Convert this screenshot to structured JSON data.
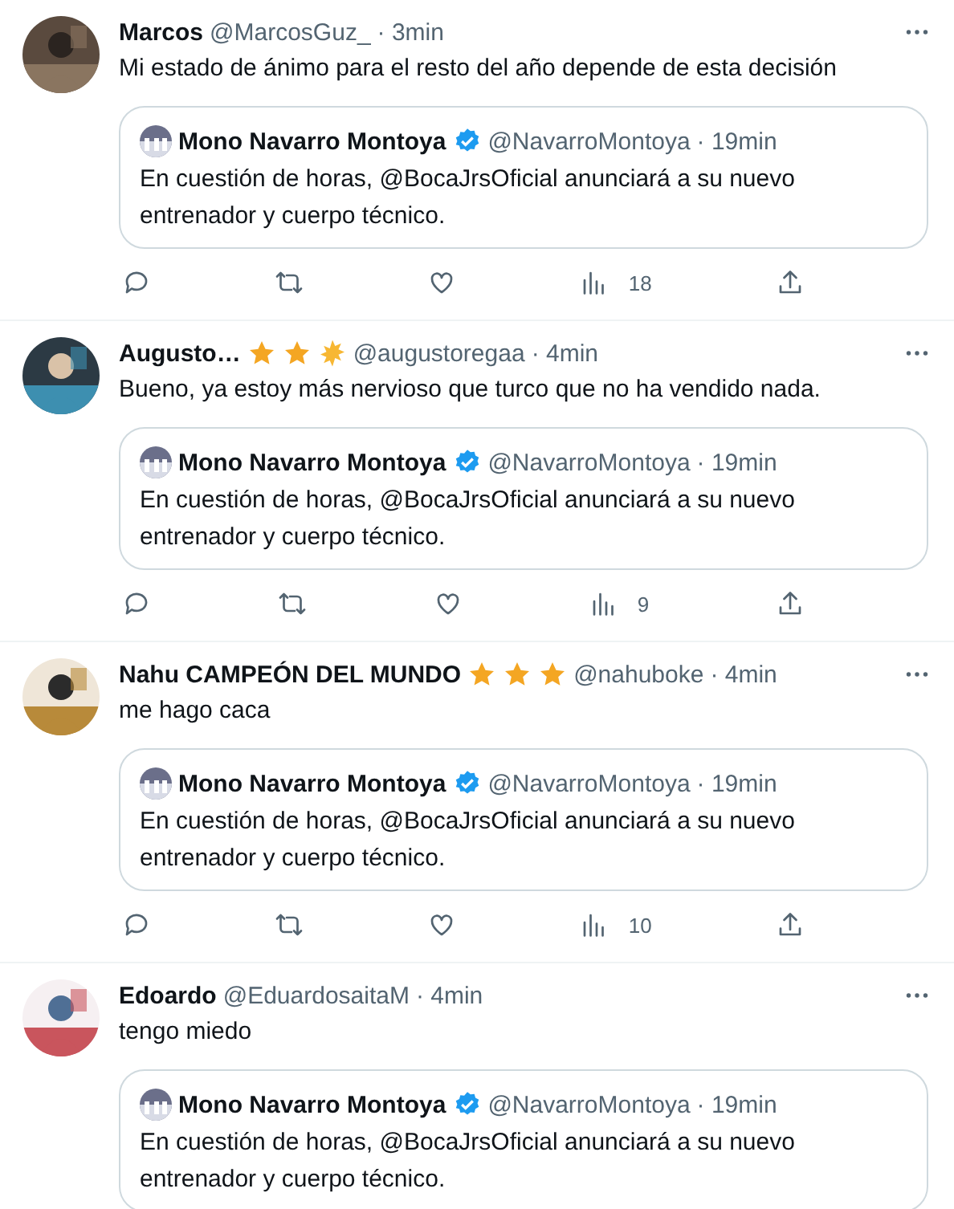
{
  "tweets": [
    {
      "avatar": {
        "kind": "picture"
      },
      "name": "Marcos",
      "handle": "@MarcosGuz_",
      "time": "· 3min",
      "text": "Mi estado de ánimo para el resto del año depende de esta decisión",
      "quote": {
        "avatar": {
          "kind": "picture"
        },
        "name": "Mono Navarro Montoya",
        "verified": true,
        "handle": "@NavarroMontoya",
        "time": "· 19min",
        "text": "En cuestión de horas, @BocaJrsOficial anunciará a su nuevo entrenador y cuerpo técnico."
      },
      "views": "18"
    },
    {
      "avatar": {
        "kind": "picture"
      },
      "name": "Augusto…",
      "badges": [
        {
          "kind": "star"
        },
        {
          "kind": "star"
        },
        {
          "kind": "burst"
        }
      ],
      "handle": "@augustoregaa",
      "time": "· 4min",
      "text": "Bueno, ya estoy más nervioso que turco que no ha vendido nada.",
      "quote": {
        "avatar": {
          "kind": "picture"
        },
        "name": "Mono Navarro Montoya",
        "verified": true,
        "handle": "@NavarroMontoya",
        "time": "· 19min",
        "text": "En cuestión de horas, @BocaJrsOficial anunciará a su nuevo entrenador y cuerpo técnico."
      },
      "views": "9"
    },
    {
      "avatar": {
        "kind": "picture"
      },
      "name": "Nahu CAMPEÓN DEL MUNDO",
      "badges": [
        {
          "kind": "star"
        },
        {
          "kind": "star"
        },
        {
          "kind": "star"
        }
      ],
      "handle": "@nahuboke",
      "time": "· 4min",
      "text": "me hago caca",
      "quote": {
        "avatar": {
          "kind": "picture"
        },
        "name": "Mono Navarro Montoya",
        "verified": true,
        "handle": "@NavarroMontoya",
        "time": "· 19min",
        "text": "En cuestión de horas, @BocaJrsOficial anunciará a su nuevo entrenador y cuerpo técnico."
      },
      "views": "10"
    },
    {
      "avatar": {
        "kind": "picture"
      },
      "name": "Edoardo",
      "handle": "@EduardosaitaM",
      "time": "· 4min",
      "text": "tengo miedo",
      "quote": {
        "avatar": {
          "kind": "picture"
        },
        "name": "Mono Navarro Montoya",
        "verified": true,
        "handle": "@NavarroMontoya",
        "time": "· 19min",
        "text": "En cuestión de horas, @BocaJrsOficial anunciará a su nuevo entrenador y cuerpo técnico."
      }
    }
  ]
}
